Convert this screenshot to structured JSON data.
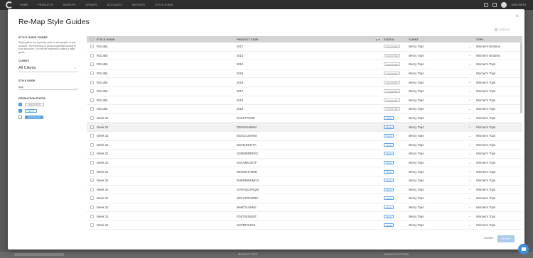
{
  "topbar": {
    "nav": [
      "HOME",
      "PRODUCTS",
      "SAMPLES",
      "ORDERS",
      "ACCOUNTS",
      "REPORTS",
      "STYLE GUIDE"
    ],
    "user": "JANE SMITH"
  },
  "background": {
    "cells": [
      "WOMEN'S TOPS",
      "WOMEN'S BOTTOMS"
    ]
  },
  "modal": {
    "title": "Re-Map Style Guides",
    "close_icon": "×",
    "sidebar": {
      "heading": "STYLE GUIDE FINDER",
      "description": "Style guides are typically used on all samples of this account. The list below is all accounts that belong to your accounts. You will be required to select a style guide.",
      "clients_label": "CLIENTS",
      "clients_value": "All Clients",
      "style_guide_label": "STYLE GUIDE",
      "style_guide_value": "Any",
      "production_status_label": "PRODUCTION STATUS",
      "statuses": [
        {
          "label": "UNMAPPED",
          "checked": true,
          "style": "grey"
        },
        {
          "label": "TECH",
          "checked": true,
          "style": "outline"
        },
        {
          "label": "APPROVED",
          "checked": false,
          "style": "solid"
        }
      ]
    },
    "search_placeholder": "SEARCH",
    "table": {
      "headers": [
        "STYLE GUIDE",
        "PRODUCT CODE",
        "STATUS",
        "CLIENT",
        "TYPE"
      ],
      "sort_icon": "▲▼",
      "rows": [
        {
          "sg": "RG1484",
          "pc": "2017",
          "status": "UNMAPPED",
          "client": "Mercy Tops",
          "arrow": "→",
          "type": "Women's Bottoms"
        },
        {
          "sg": "RG1484",
          "pc": "2013",
          "status": "UNMAPPED",
          "client": "Mercy Tops",
          "arrow": "→",
          "type": "Women's Bottoms"
        },
        {
          "sg": "RG1484",
          "pc": "2014",
          "status": "UNMAPPED",
          "client": "Mercy Tops",
          "arrow": "→",
          "type": "Women's Tops"
        },
        {
          "sg": "RG1484",
          "pc": "2016",
          "status": "UNMAPPED",
          "client": "Mercy Tops",
          "arrow": "→",
          "type": "Women's Tops"
        },
        {
          "sg": "RG1484",
          "pc": "2018",
          "status": "UNMAPPED",
          "client": "Mercy Tops",
          "arrow": "→",
          "type": "Women's Tops"
        },
        {
          "sg": "RG1484",
          "pc": "2017",
          "status": "UNMAPPED",
          "client": "Mercy Tops",
          "arrow": "→",
          "type": "Women's Tops"
        },
        {
          "sg": "RG1484",
          "pc": "2019",
          "status": "UNMAPPED",
          "client": "Mercy Tops",
          "arrow": "→",
          "type": "Women's Tops"
        },
        {
          "sg": "RG1484",
          "pc": "2019",
          "status": "UNMAPPED",
          "client": "Mercy Tops",
          "arrow": "→",
          "type": "Women's Tops"
        },
        {
          "sg": "Week 31",
          "pc": "GALETTONE",
          "status": "TECH",
          "client": "Mercy Tops",
          "arrow": "→",
          "type": "Women's Tops"
        },
        {
          "sg": "Week 31",
          "pc": "DRHHGHBMN",
          "status": "TECH",
          "client": "Mercy Tops",
          "arrow": "→",
          "type": "Women's Tops"
        },
        {
          "sg": "Week 31",
          "pc": "BGXCAJDHHS",
          "status": "TECH",
          "client": "Mercy Tops",
          "arrow": "→",
          "type": "Women's Tops"
        },
        {
          "sg": "Week 31",
          "pc": "BGVRJNHTTA",
          "status": "TECH",
          "client": "Mercy Tops",
          "arrow": "→",
          "type": "Women's Tops"
        },
        {
          "sg": "Week 31",
          "pc": "GSMMBRRRSC",
          "status": "TECH",
          "client": "Mercy Tops",
          "arrow": "→",
          "type": "Women's Tops"
        },
        {
          "sg": "Week 31",
          "pc": "GSXVMGJSTF",
          "status": "TECH",
          "client": "Mercy Tops",
          "arrow": "→",
          "type": "Women's Tops"
        },
        {
          "sg": "Week 31",
          "pc": "BRHNGTTBRD",
          "status": "TECH",
          "client": "Mercy Tops",
          "arrow": "→",
          "type": "Women's Tops"
        },
        {
          "sg": "Week 31",
          "pc": "RHBDMMHMG4",
          "status": "TECH",
          "client": "Mercy Tops",
          "arrow": "→",
          "type": "Women's Tops"
        },
        {
          "sg": "Week 31",
          "pc": "GVHVQGXRQM",
          "status": "TECH",
          "client": "Mercy Tops",
          "arrow": "→",
          "type": "Women's Tops"
        },
        {
          "sg": "Week 31",
          "pc": "MGHHTRHDRP",
          "status": "TECH",
          "client": "Mercy Tops",
          "arrow": "→",
          "type": "Women's Tops"
        },
        {
          "sg": "Week 31",
          "pc": "MHBTSJJHMJ",
          "status": "TECH",
          "client": "Mercy Tops",
          "arrow": "→",
          "type": "Women's Tops"
        },
        {
          "sg": "Week 31",
          "pc": "FDSTWJNJMT",
          "status": "TECH",
          "client": "Mercy Tops",
          "arrow": "→",
          "type": "Women's Tops"
        },
        {
          "sg": "Week 31",
          "pc": "GSTBTGHHG",
          "status": "TECH",
          "client": "Mercy Tops",
          "arrow": "→",
          "type": "Women's Tops"
        }
      ]
    },
    "close_label": "CLOSE",
    "save_label": "REMAP"
  }
}
